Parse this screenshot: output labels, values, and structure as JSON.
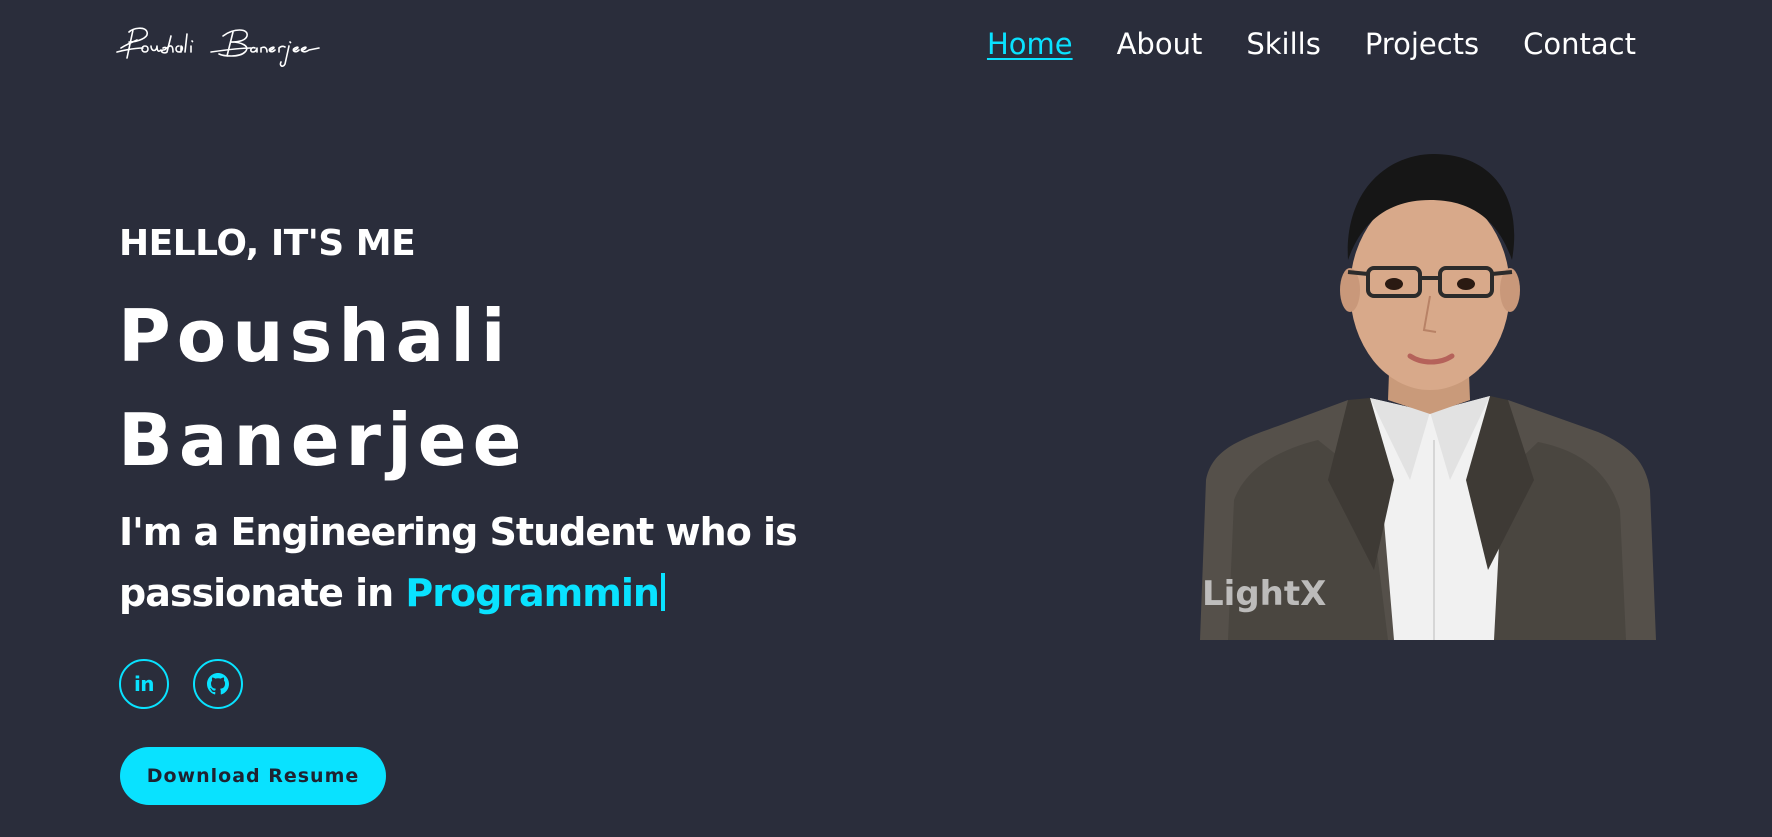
{
  "header": {
    "logo_text": "Poushali Banerjee",
    "nav": [
      {
        "label": "Home",
        "active": true
      },
      {
        "label": "About",
        "active": false
      },
      {
        "label": "Skills",
        "active": false
      },
      {
        "label": "Projects",
        "active": false
      },
      {
        "label": "Contact",
        "active": false
      }
    ]
  },
  "hero": {
    "greeting": "HELLO, IT'S ME",
    "name_first": "Poushali",
    "name_last": "Banerjee",
    "tagline_prefix": "I'm a Engineering Student who is passionate in ",
    "tagline_typed": "Programmin",
    "download_label": "Download Resume"
  },
  "social": {
    "linkedin_label": "in",
    "linkedin_icon": "linkedin-icon",
    "github_icon": "github-icon"
  },
  "portrait": {
    "watermark": "LightX"
  },
  "colors": {
    "background": "#2a2d3b",
    "accent": "#09e2ff",
    "text": "#ffffff"
  }
}
